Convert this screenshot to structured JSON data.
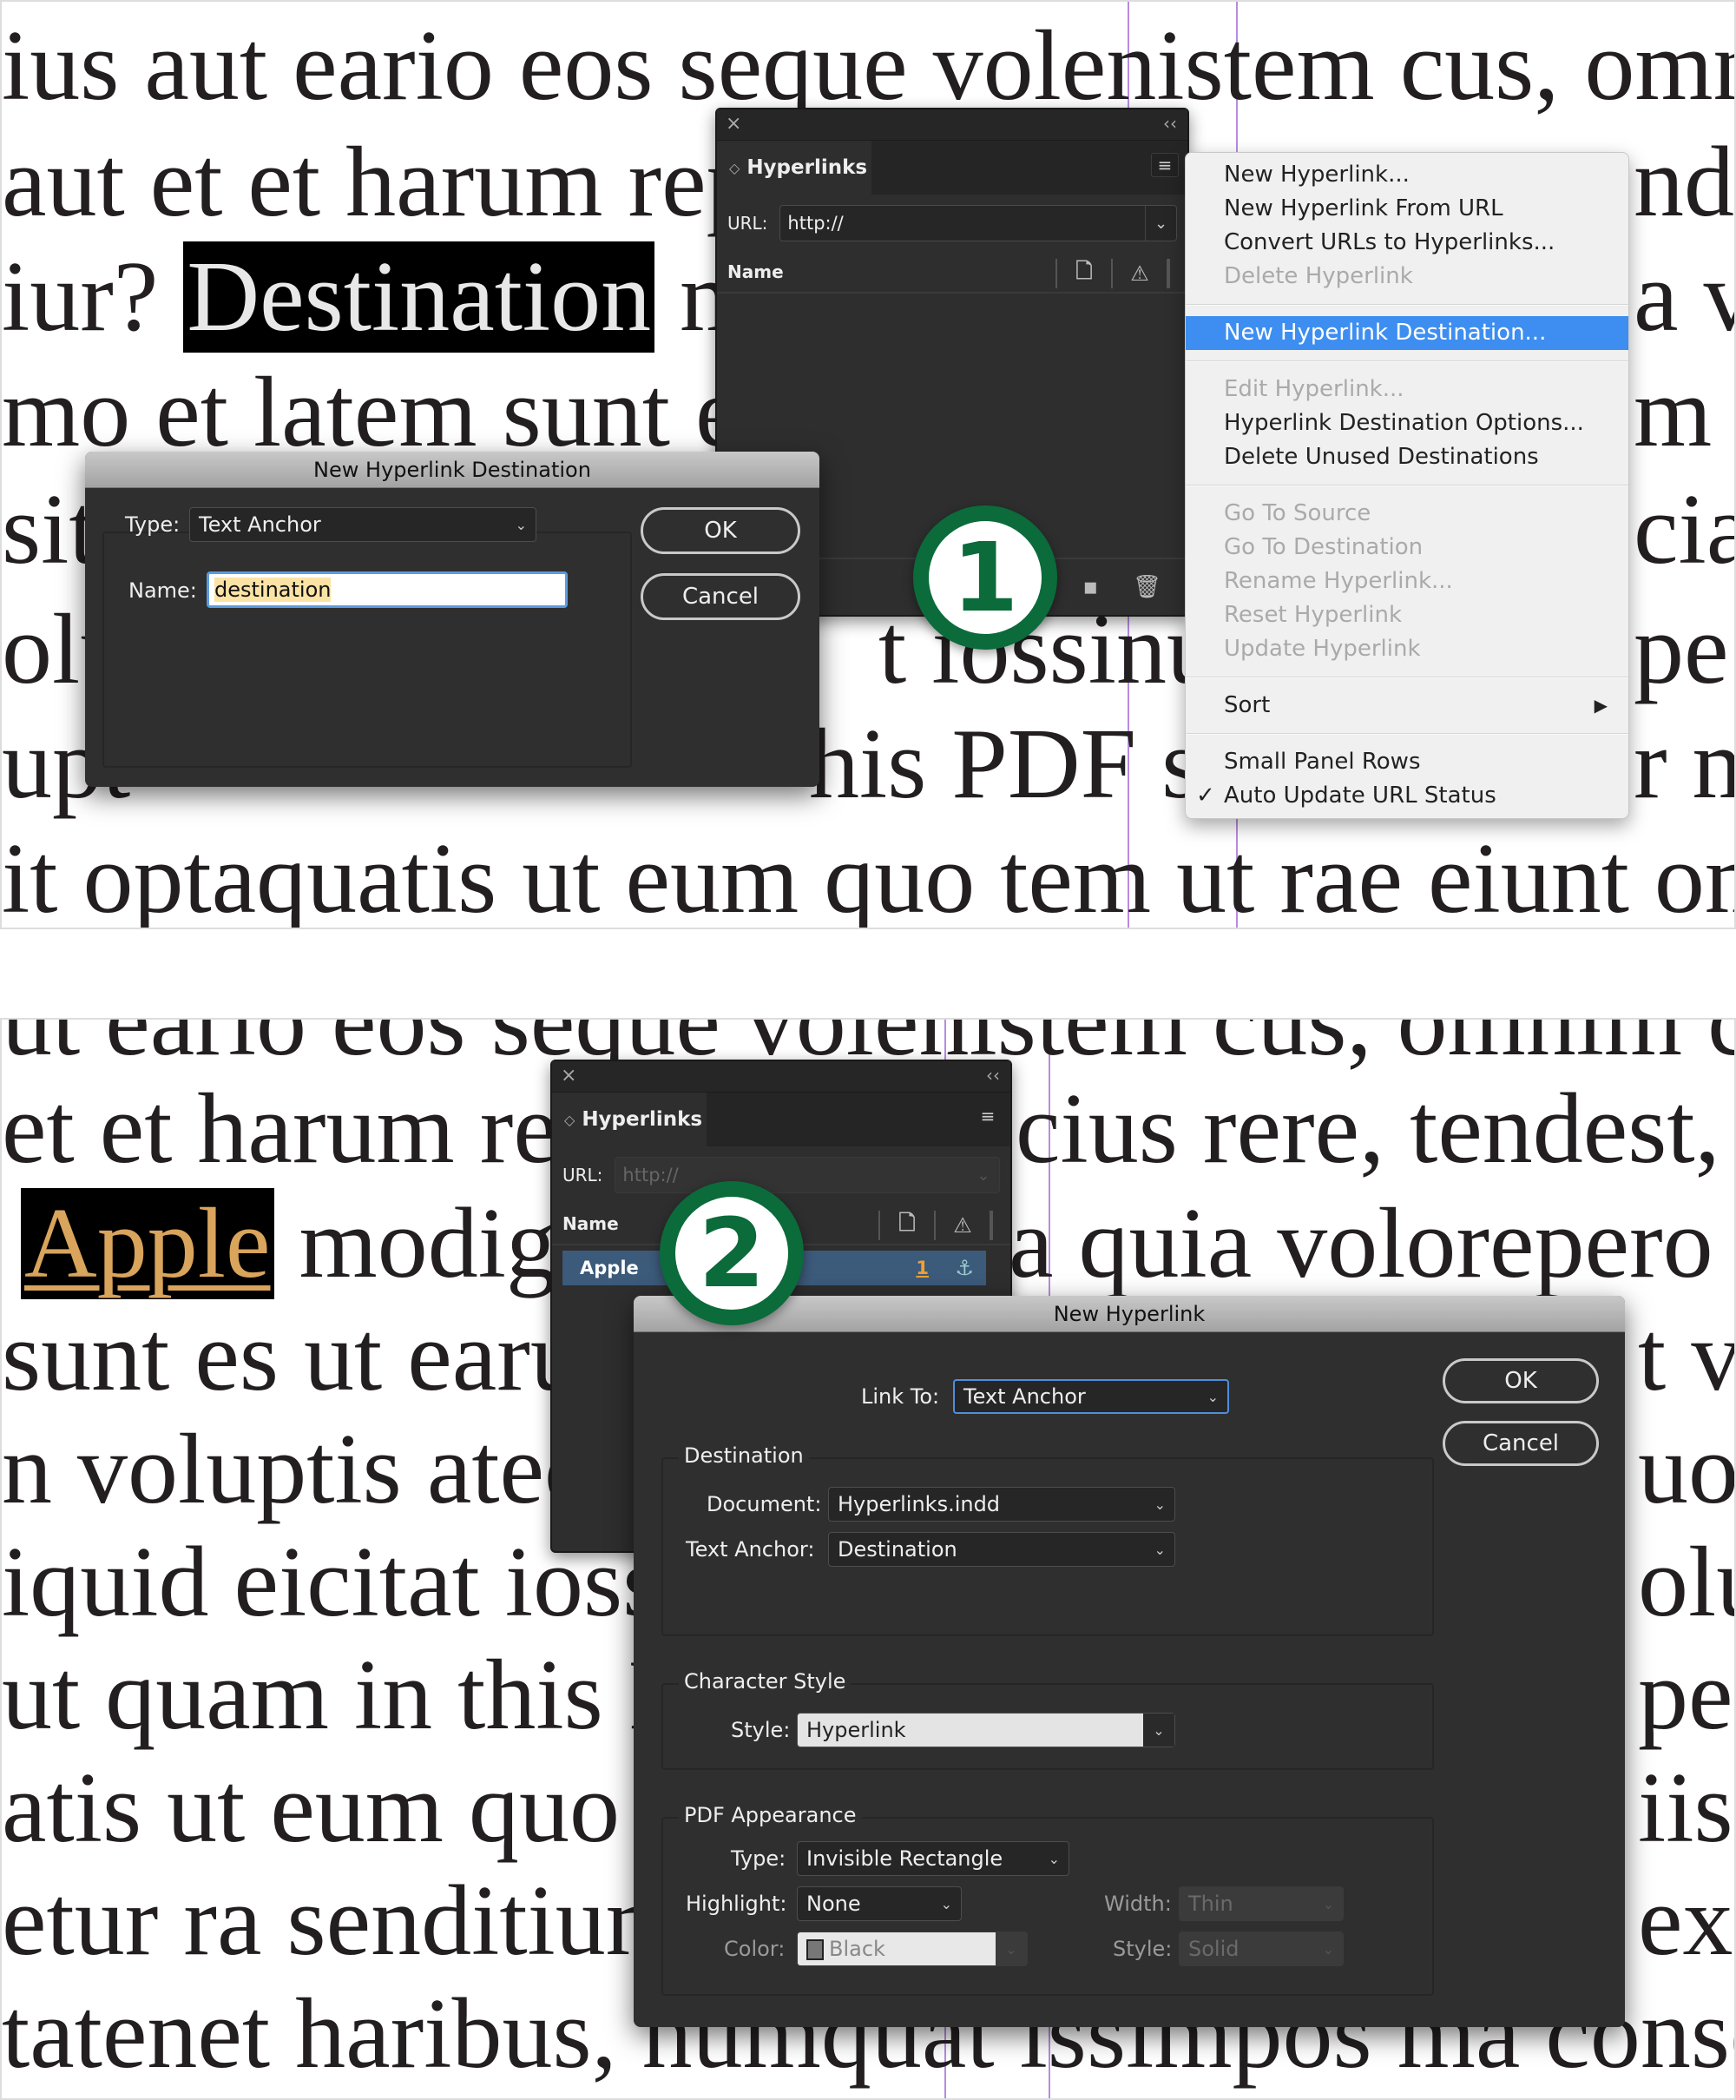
{
  "step1": {
    "badge": "1",
    "body_lines": [
      "ius aut eario eos seque volenistem cus, omnir",
      "aut et et harum rep",
      "iur? ",
      "mo et latem sunt es",
      "sita",
      "olu",
      "upt",
      "it optaquatis ut eum quo tem ut rae eiunt om"
    ],
    "body_line_right_fragments": [
      "nde",
      "a vo",
      "m v",
      "cia",
      "pe",
      "r m"
    ],
    "body_mid_fragments": [
      "t iossinu",
      "his PDF sa"
    ],
    "selected_word": "Destination",
    "after_selected": " m",
    "panel": {
      "close_icon": "×",
      "collapse_icon": "‹‹",
      "tab_label": "Hyperlinks",
      "menu_icon": "≡",
      "url_label": "URL:",
      "url_value": "http://",
      "name_header": "Name",
      "page_icon": "🗋",
      "warning_icon": "⚠",
      "new_icon": "▪",
      "trash_icon": "🗑"
    },
    "menu": {
      "items": [
        {
          "label": "New Hyperlink...",
          "disabled": false
        },
        {
          "label": "New Hyperlink From URL",
          "disabled": false
        },
        {
          "label": "Convert URLs to Hyperlinks...",
          "disabled": false
        },
        {
          "label": "Delete Hyperlink",
          "disabled": true
        },
        {
          "separator": true
        },
        {
          "label": "New Hyperlink Destination...",
          "selected": true
        },
        {
          "separator": true
        },
        {
          "label": "Edit Hyperlink...",
          "disabled": true
        },
        {
          "label": "Hyperlink Destination Options...",
          "disabled": false
        },
        {
          "label": "Delete Unused Destinations",
          "disabled": false
        },
        {
          "separator": true
        },
        {
          "label": "Go To Source",
          "disabled": true
        },
        {
          "label": "Go To Destination",
          "disabled": true
        },
        {
          "label": "Rename Hyperlink...",
          "disabled": true
        },
        {
          "label": "Reset Hyperlink",
          "disabled": true
        },
        {
          "label": "Update Hyperlink",
          "disabled": true
        },
        {
          "separator": true
        },
        {
          "label": "Sort",
          "submenu": true
        },
        {
          "separator": true
        },
        {
          "label": "Small Panel Rows",
          "disabled": false
        },
        {
          "label": "Auto Update URL Status",
          "checked": true
        }
      ]
    },
    "dialog": {
      "title": "New Hyperlink Destination",
      "type_label": "Type:",
      "type_value": "Text Anchor",
      "name_label": "Name:",
      "name_value": "destination",
      "ok": "OK",
      "cancel": "Cancel"
    }
  },
  "step2": {
    "badge": "2",
    "body_lines": [
      "ut eario eos seque volenistem cus, omnim com",
      "et et harum rep",
      "",
      "sunt es ut earu",
      "n voluptis atec",
      "iquid eicitat iossi",
      "ut quam in this P",
      "atis ut eum quo te",
      "etur ra senditium",
      "tatenet haribus, numquat issimpos ma consed"
    ],
    "right_fragments": [
      "cius rere, tendest, co",
      "a quia volorepero co",
      "t vo",
      "uo",
      "olup",
      "peru",
      "iis",
      "ex"
    ],
    "linked_word": "Apple",
    "after_linked": " modige",
    "panel": {
      "close_icon": "×",
      "collapse_icon": "‹‹",
      "tab_label": "Hyperlinks",
      "menu_icon": "≡",
      "url_label": "URL:",
      "url_value": "http://",
      "name_header": "Name",
      "row_name": "Apple",
      "row_count": "1",
      "anchor_icon": "⚓",
      "page_icon": "🗋",
      "warning_icon": "⚠"
    },
    "dialog": {
      "title": "New Hyperlink",
      "link_to_label": "Link To:",
      "link_to_value": "Text Anchor",
      "ok": "OK",
      "cancel": "Cancel",
      "destination": {
        "title": "Destination",
        "document_label": "Document:",
        "document_value": "Hyperlinks.indd",
        "anchor_label": "Text Anchor:",
        "anchor_value": "Destination"
      },
      "character_style": {
        "title": "Character Style",
        "style_label": "Style:",
        "style_value": "Hyperlink"
      },
      "pdf_appearance": {
        "title": "PDF Appearance",
        "type_label": "Type:",
        "type_value": "Invisible Rectangle",
        "highlight_label": "Highlight:",
        "highlight_value": "None",
        "color_label": "Color:",
        "color_value": "Black",
        "width_label": "Width:",
        "width_value": "Thin",
        "style_label": "Style:",
        "style_value": "Solid"
      }
    }
  },
  "colors": {
    "badge_green": "#0b6b3a",
    "menu_highlight": "#3d8ef0",
    "row_highlight": "#3c5a7a",
    "link_text": "#d9a45c"
  }
}
